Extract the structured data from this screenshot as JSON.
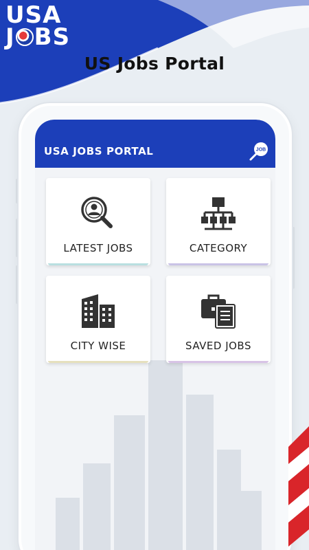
{
  "logo": {
    "line1": "USA",
    "line2_a": "J",
    "line2_b": "BS"
  },
  "headline": "US Jobs Portal",
  "app": {
    "title": "USA JOBS PORTAL",
    "search_icon_label": "JOB",
    "brand_color": "#1c3fb9"
  },
  "menu": [
    {
      "label": "LATEST JOBS",
      "icon": "search-person-icon",
      "accent": "#b9dfe0"
    },
    {
      "label": "CATEGORY",
      "icon": "hierarchy-icon",
      "accent": "#c9c3e6"
    },
    {
      "label": "CITY WISE",
      "icon": "buildings-icon",
      "accent": "#e6e0be"
    },
    {
      "label": "SAVED JOBS",
      "icon": "briefcase-document-icon",
      "accent": "#d8c3e6"
    }
  ]
}
